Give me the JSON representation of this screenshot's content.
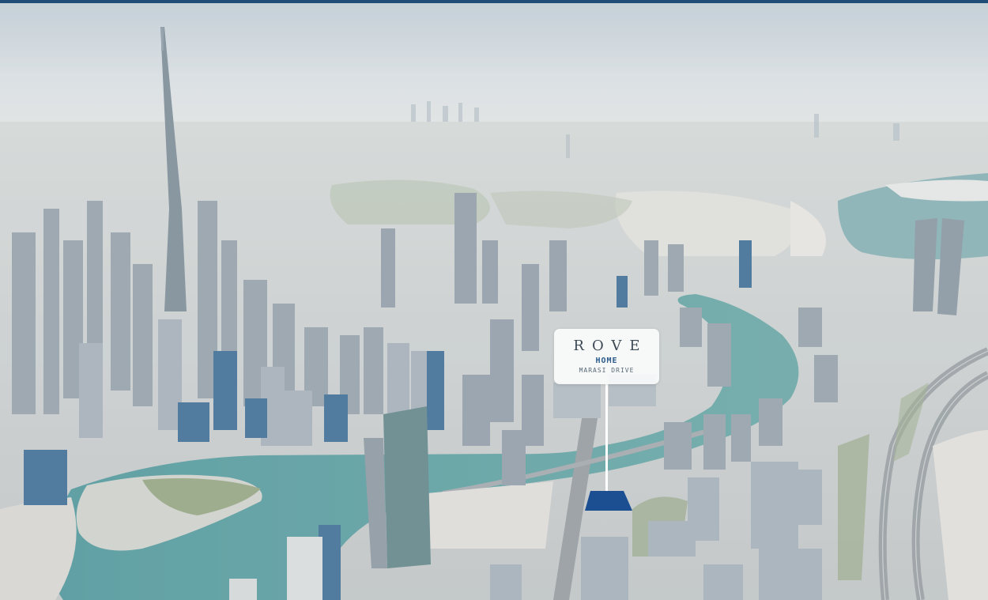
{
  "colors": {
    "accent_bar": "#1f4d77",
    "plot_marker": "#1c4f92",
    "water": "#4f9594",
    "sky": "#c6d0d6"
  },
  "location_pin": {
    "title": "ROVE",
    "subtitle": "HOME",
    "location": "MARASI DRIVE"
  }
}
